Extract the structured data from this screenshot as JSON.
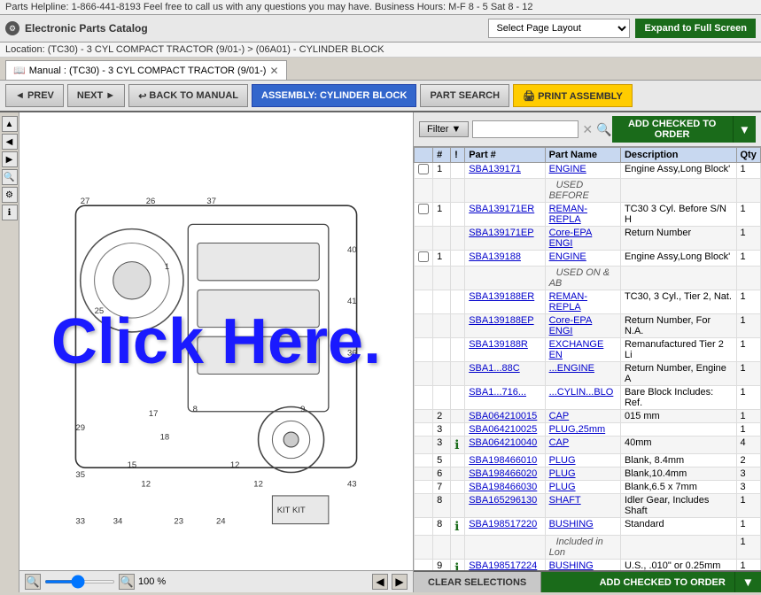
{
  "topbar": {
    "helpline": "Parts Helpline: 1-866-441-8193 Feel free to call us with any questions you may have. Business Hours: M-F 8 - 5 Sat 8 - 12"
  },
  "header": {
    "logo_label": "E",
    "title": "Electronic Parts Catalog",
    "page_layout_placeholder": "Select Page Layout",
    "expand_label": "Expand to Full Screen"
  },
  "breadcrumb": {
    "text": "Location: (TC30) - 3 CYL COMPACT TRACTOR (9/01-) > (06A01) - CYLINDER BLOCK"
  },
  "tab": {
    "label": "Manual : (TC30) - 3 CYL COMPACT TRACTOR (9/01-)"
  },
  "toolbar": {
    "prev_label": "◄ PREV",
    "next_label": "NEXT ►",
    "back_label": "BACK TO MANUAL",
    "assembly_label": "ASSEMBLY: CYLINDER BLOCK",
    "part_search_label": "PART SEARCH",
    "print_label": "🖨 PRINT ASSEMBLY"
  },
  "filter": {
    "label": "Filter",
    "placeholder": "",
    "add_order_label": "ADD CHECKED TO ORDER"
  },
  "table": {
    "headers": [
      "",
      "#",
      "!",
      "Part #",
      "Part Name",
      "Description",
      "Qty"
    ],
    "rows": [
      {
        "cb": true,
        "num": "1",
        "info": false,
        "part": "SBA139171",
        "name": "ENGINE",
        "desc": "Engine Assy,Long Block'",
        "qty": "1",
        "indent": false
      },
      {
        "cb": false,
        "num": "",
        "info": false,
        "part": "",
        "name": "USED BEFORE",
        "desc": "",
        "qty": "",
        "indent": true
      },
      {
        "cb": true,
        "num": "1",
        "info": false,
        "part": "SBA139171ER",
        "name": "REMAN-REPLA",
        "desc": "TC30 3 Cyl. Before S/N H",
        "qty": "1",
        "indent": false
      },
      {
        "cb": false,
        "num": "",
        "info": false,
        "part": "SBA139171EP",
        "name": "Core-EPA ENGI",
        "desc": "Return Number",
        "qty": "1",
        "indent": false
      },
      {
        "cb": true,
        "num": "1",
        "info": false,
        "part": "SBA139188",
        "name": "ENGINE",
        "desc": "Engine Assy,Long Block'",
        "qty": "1",
        "indent": false
      },
      {
        "cb": false,
        "num": "",
        "info": false,
        "part": "",
        "name": "USED ON & AB",
        "desc": "",
        "qty": "",
        "indent": true
      },
      {
        "cb": false,
        "num": "",
        "info": false,
        "part": "SBA139188ER",
        "name": "REMAN-REPLA",
        "desc": "TC30, 3 Cyl., Tier 2, Nat.",
        "qty": "1",
        "indent": false
      },
      {
        "cb": false,
        "num": "",
        "info": false,
        "part": "SBA139188EP",
        "name": "Core-EPA ENGI",
        "desc": "Return Number, For N.A.",
        "qty": "1",
        "indent": false
      },
      {
        "cb": false,
        "num": "",
        "info": false,
        "part": "SBA139188R",
        "name": "EXCHANGE EN",
        "desc": "Remanufactured Tier 2 Li",
        "qty": "1",
        "indent": false
      },
      {
        "cb": false,
        "num": "",
        "info": false,
        "part": "SBA1...88C",
        "name": "...ENGINE",
        "desc": "Return Number, Engine A",
        "qty": "1",
        "indent": false
      },
      {
        "cb": false,
        "num": "",
        "info": false,
        "part": "SBA1...716...",
        "name": "...CYLIN...BLO",
        "desc": "Bare Block Includes: Ref.",
        "qty": "1",
        "indent": false
      },
      {
        "cb": false,
        "num": "2",
        "info": false,
        "part": "SBA064210015",
        "name": "CAP",
        "desc": "015 mm",
        "qty": "1",
        "indent": false
      },
      {
        "cb": false,
        "num": "3",
        "info": false,
        "part": "SBA064210025",
        "name": "PLUG,25mm",
        "desc": "",
        "qty": "1",
        "indent": false
      },
      {
        "cb": false,
        "num": "3",
        "info": true,
        "part": "SBA064210040",
        "name": "CAP",
        "desc": "40mm",
        "qty": "4",
        "indent": false
      },
      {
        "cb": false,
        "num": "5",
        "info": false,
        "part": "SBA198466010",
        "name": "PLUG",
        "desc": "Blank, 8.4mm",
        "qty": "2",
        "indent": false
      },
      {
        "cb": false,
        "num": "6",
        "info": false,
        "part": "SBA198466020",
        "name": "PLUG",
        "desc": "Blank,10.4mm",
        "qty": "3",
        "indent": false
      },
      {
        "cb": false,
        "num": "7",
        "info": false,
        "part": "SBA198466030",
        "name": "PLUG",
        "desc": "Blank,6.5 x 7mm",
        "qty": "3",
        "indent": false
      },
      {
        "cb": false,
        "num": "8",
        "info": false,
        "part": "SBA165296130",
        "name": "SHAFT",
        "desc": "Idler Gear, Includes Shaft",
        "qty": "1",
        "indent": false
      },
      {
        "cb": false,
        "num": "8",
        "info": true,
        "part": "SBA198517220",
        "name": "BUSHING",
        "desc": "Standard",
        "qty": "1",
        "indent": false
      },
      {
        "cb": false,
        "num": "",
        "info": false,
        "part": "",
        "name": "Included in Lon",
        "desc": "",
        "qty": "1",
        "indent": true
      },
      {
        "cb": false,
        "num": "9",
        "info": true,
        "part": "SBA198517224",
        "name": "BUSHING",
        "desc": "U.S., .010\" or 0.25mm",
        "qty": "1",
        "indent": false
      }
    ]
  },
  "footer": {
    "clear_label": "CLEAR SELECTIONS",
    "add_order_label": "ADD CHECKED TO ORDER"
  },
  "zoom": {
    "percent": "100 %"
  },
  "diagram": {
    "click_here": "Click Here."
  }
}
